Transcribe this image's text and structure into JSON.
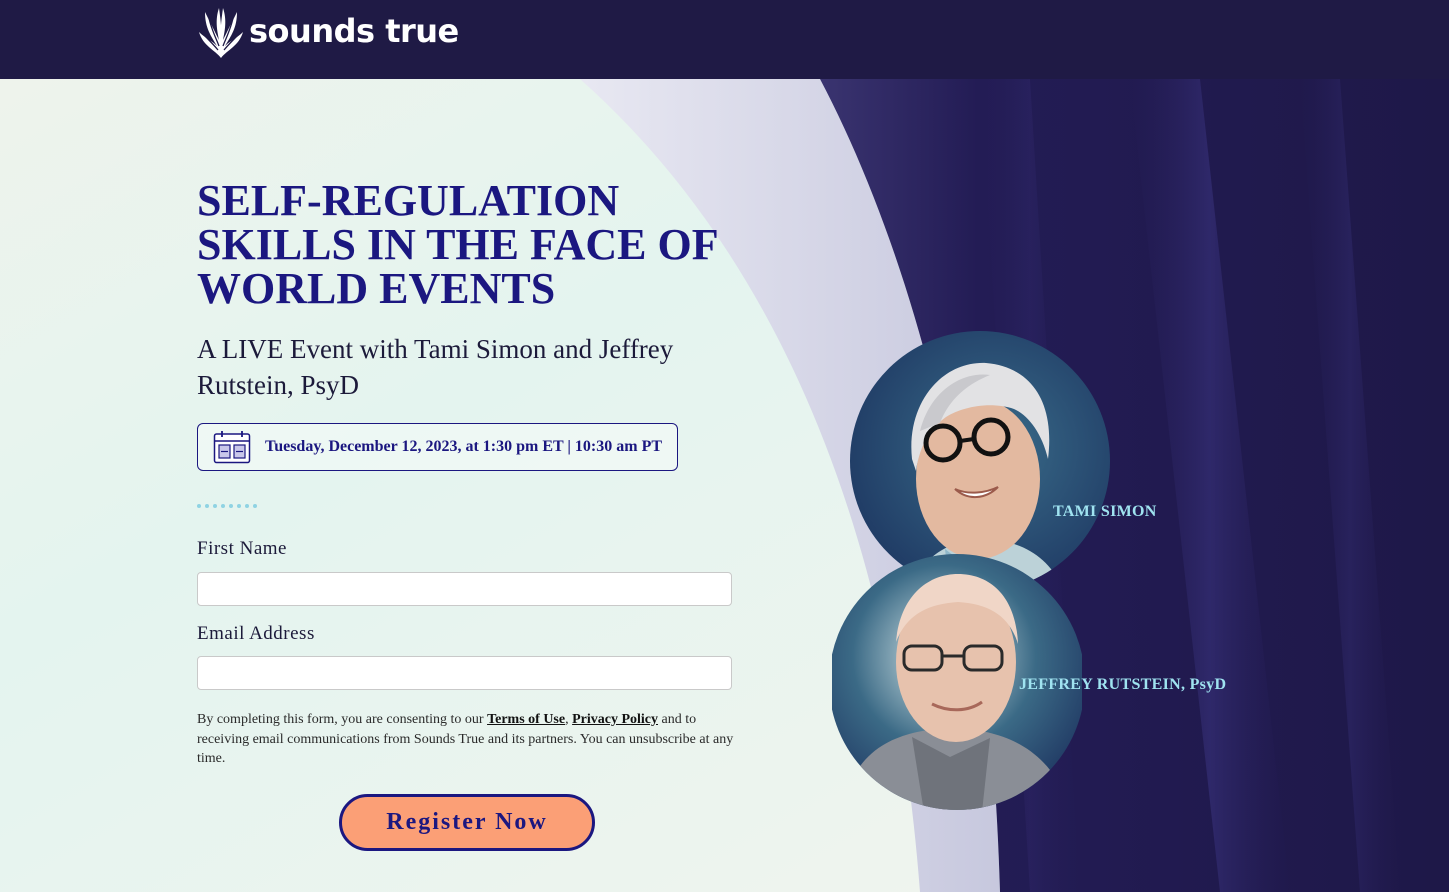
{
  "header": {
    "logo_text": "sounds true",
    "logo_icon": "winged-flame-logo"
  },
  "hero": {
    "title": "SELF-REGULATION SKILLS IN THE FACE OF WORLD EVENTS",
    "subtitle": "A LIVE Event with Tami Simon and Jeffrey Rutstein, PsyD",
    "date_icon": "calendar-icon",
    "date_text": "Tuesday, December 12, 2023, at 1:30 pm ET | 10:30 am PT"
  },
  "form": {
    "first_name_label": "First Name",
    "first_name_value": "",
    "email_label": "Email Address",
    "email_value": "",
    "consent_pre": "By completing this form, you are consenting to our ",
    "terms_link": "Terms of Use",
    "comma": ", ",
    "privacy_link": "Privacy Policy",
    "consent_post": " and to receiving email communications from Sounds True and its partners. You can unsubscribe at any time.",
    "submit_label": "Register Now"
  },
  "speakers": [
    {
      "name": "TAMI SIMON"
    },
    {
      "name": "JEFFREY RUTSTEIN, PsyD"
    }
  ],
  "colors": {
    "header_bg": "#1f1a45",
    "title": "#1b1780",
    "button_bg": "#fb9f76",
    "speaker_name": "#9fe3f0",
    "right_panel": "#221b52"
  }
}
